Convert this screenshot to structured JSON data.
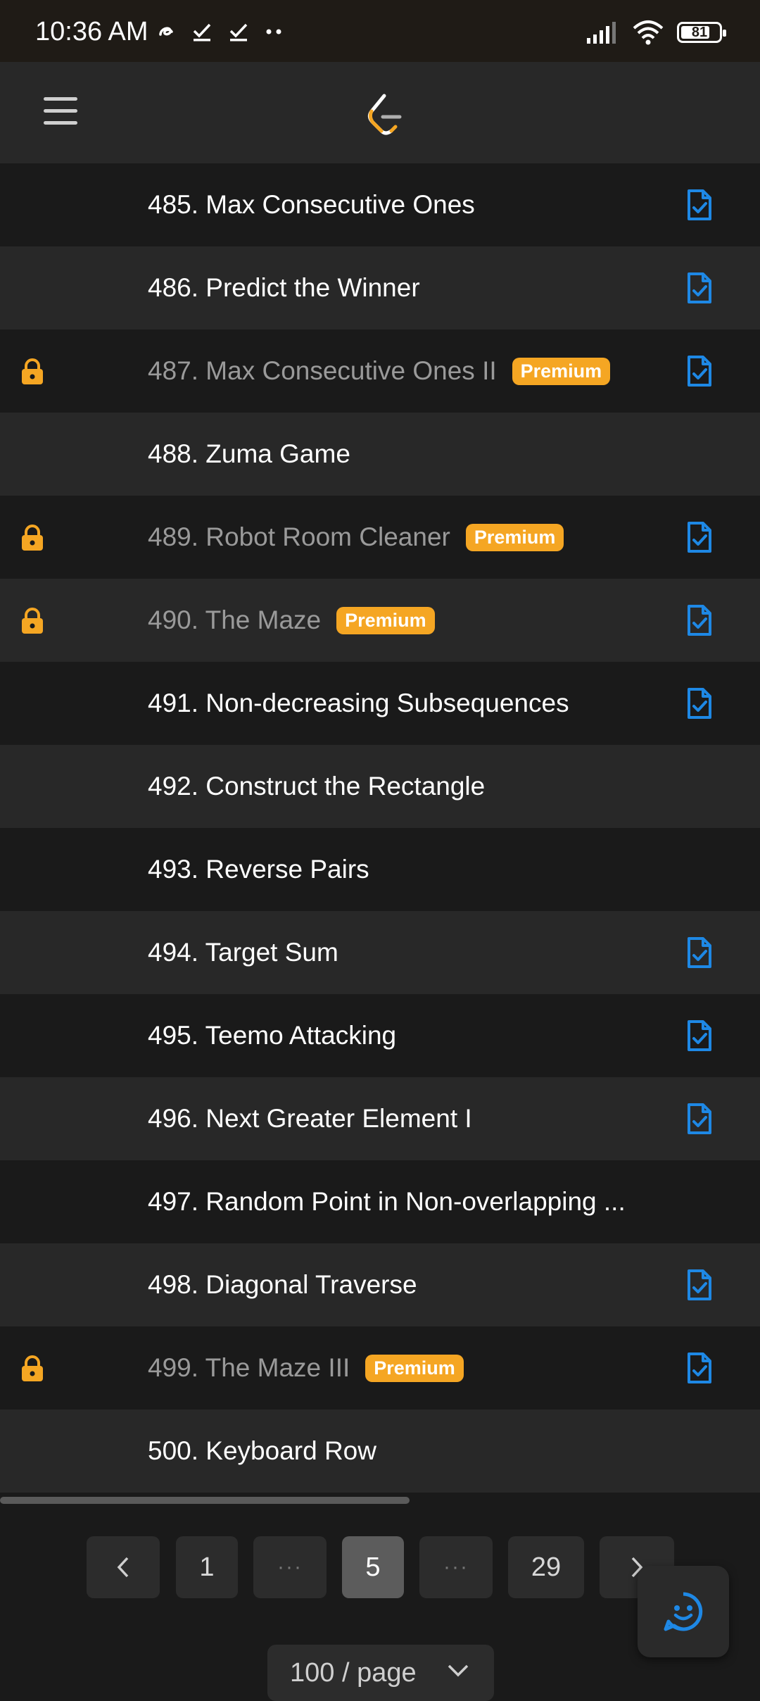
{
  "status_bar": {
    "time": "10:36 AM",
    "battery": "81",
    "icons_left": [
      "gesture-icon",
      "check-download-icon",
      "check-download-icon",
      "more-dots-icon"
    ],
    "icons_right": [
      "signal-icon",
      "wifi-icon",
      "battery-icon"
    ]
  },
  "header": {
    "menu_icon": "hamburger-menu-icon",
    "logo": "leetcode-logo"
  },
  "colors": {
    "accent_premium": "#f5a623",
    "solution_icon": "#1e88e5",
    "row_dark": "#1a1a1a",
    "row_light": "#282828"
  },
  "problems": [
    {
      "title": "485. Max Consecutive Ones",
      "locked": false,
      "badge": "",
      "solution": true
    },
    {
      "title": "486. Predict the Winner",
      "locked": false,
      "badge": "",
      "solution": true
    },
    {
      "title": "487. Max Consecutive Ones II",
      "locked": true,
      "badge": "Premium",
      "solution": true
    },
    {
      "title": "488. Zuma Game",
      "locked": false,
      "badge": "",
      "solution": false
    },
    {
      "title": "489. Robot Room Cleaner",
      "locked": true,
      "badge": "Premium",
      "solution": true
    },
    {
      "title": "490. The Maze",
      "locked": true,
      "badge": "Premium",
      "solution": true
    },
    {
      "title": "491. Non-decreasing Subsequences",
      "locked": false,
      "badge": "",
      "solution": true
    },
    {
      "title": "492. Construct the Rectangle",
      "locked": false,
      "badge": "",
      "solution": false
    },
    {
      "title": "493. Reverse Pairs",
      "locked": false,
      "badge": "",
      "solution": false
    },
    {
      "title": "494. Target Sum",
      "locked": false,
      "badge": "",
      "solution": true
    },
    {
      "title": "495. Teemo Attacking",
      "locked": false,
      "badge": "",
      "solution": true
    },
    {
      "title": "496. Next Greater Element I",
      "locked": false,
      "badge": "",
      "solution": true
    },
    {
      "title": "497. Random Point in Non-overlapping ...",
      "locked": false,
      "badge": "",
      "solution": false
    },
    {
      "title": "498. Diagonal Traverse",
      "locked": false,
      "badge": "",
      "solution": true
    },
    {
      "title": "499. The Maze III",
      "locked": true,
      "badge": "Premium",
      "solution": true
    },
    {
      "title": "500. Keyboard Row",
      "locked": false,
      "badge": "",
      "solution": false
    }
  ],
  "pagination": {
    "prev": "‹",
    "next": "›",
    "pages": [
      "1",
      "···",
      "5",
      "···",
      "29"
    ],
    "current": "5"
  },
  "per_page": {
    "label": "100 / page"
  },
  "chat_button": {
    "icon": "smiley-chat-icon"
  }
}
